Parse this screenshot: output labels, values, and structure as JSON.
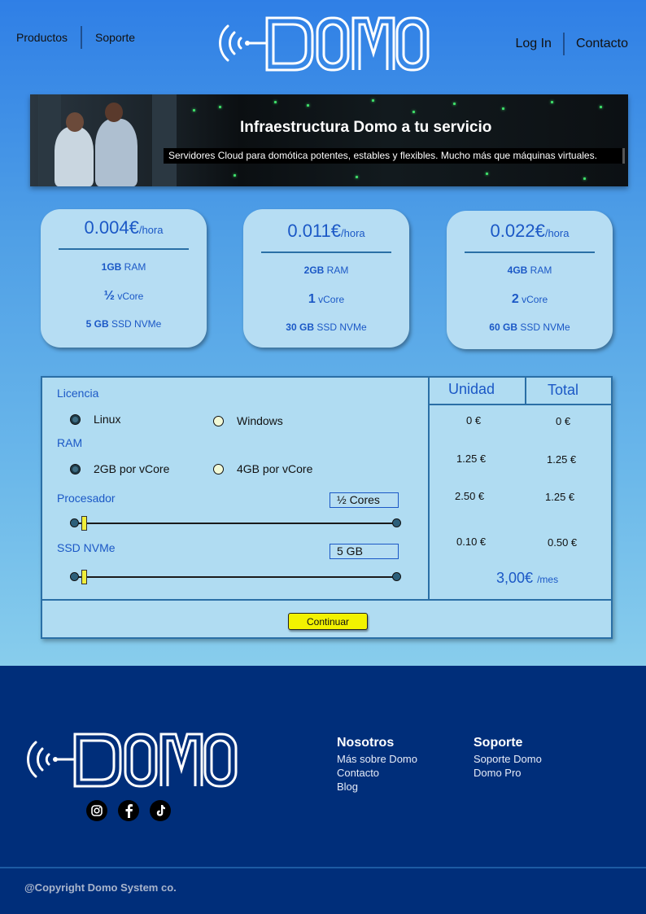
{
  "nav": {
    "left": [
      "Productos",
      "Soporte"
    ],
    "right": [
      "Log In",
      "Contacto"
    ]
  },
  "brand": {
    "logo_text": "DOMO"
  },
  "banner": {
    "title": "Infraestructura Domo a tu servicio",
    "subtitle": "Servidores Cloud para domótica potentes, estables y flexibles. Mucho más que máquinas virtuales."
  },
  "plans": [
    {
      "price": "0.004€",
      "unit": "/hora",
      "ram_value": "1GB",
      "ram_label": "RAM",
      "core_value": "½",
      "core_label": "vCore",
      "ssd_value": "5 GB",
      "ssd_label": "SSD NVMe"
    },
    {
      "price": "0.011€",
      "unit": "/hora",
      "ram_value": "2GB",
      "ram_label": "RAM",
      "core_value": "1",
      "core_label": "vCore",
      "ssd_value": "30 GB",
      "ssd_label": "SSD NVMe"
    },
    {
      "price": "0.022€",
      "unit": "/hora",
      "ram_value": "4GB",
      "ram_label": "RAM",
      "core_value": "2",
      "core_label": "vCore",
      "ssd_value": "60 GB",
      "ssd_label": "SSD NVMe"
    }
  ],
  "config": {
    "license_label": "Licencia",
    "license_options": [
      "Linux",
      "Windows"
    ],
    "license_selected": "Linux",
    "ram_label": "RAM",
    "ram_options": [
      "2GB por vCore",
      "4GB por vCore"
    ],
    "ram_selected": "2GB por vCore",
    "processor_label": "Procesador",
    "processor_value": "½ Cores",
    "processor_level": 0.02,
    "ssd_label": "SSD NVMe",
    "ssd_value": "5 GB",
    "ssd_level": 0.02,
    "columns": [
      "Unidad",
      "Total"
    ],
    "rows": [
      {
        "unit": "0 €",
        "total": "0 €"
      },
      {
        "unit": "1.25 €",
        "total": "1.25 €"
      },
      {
        "unit": "2.50 €",
        "total": "1.25 €"
      },
      {
        "unit": "0.10 €",
        "total": "0.50 €"
      }
    ],
    "grand_total": "3,00€",
    "grand_total_unit": "/mes",
    "continue_label": "Continuar"
  },
  "footer": {
    "social": [
      "instagram-icon",
      "facebook-icon",
      "tiktok-icon"
    ],
    "columns": [
      {
        "title": "Nosotros",
        "links": [
          "Más sobre Domo",
          "Contacto",
          "Blog"
        ]
      },
      {
        "title": "Soporte",
        "links": [
          "Soporte Domo",
          "Domo Pro"
        ]
      }
    ],
    "copyright": "@Copyright Domo System co."
  },
  "colors": {
    "accent": "#1b58c6",
    "card_bg": "#b6ddf3",
    "footer_bg": "#002e7a",
    "button": "#f2f200"
  }
}
